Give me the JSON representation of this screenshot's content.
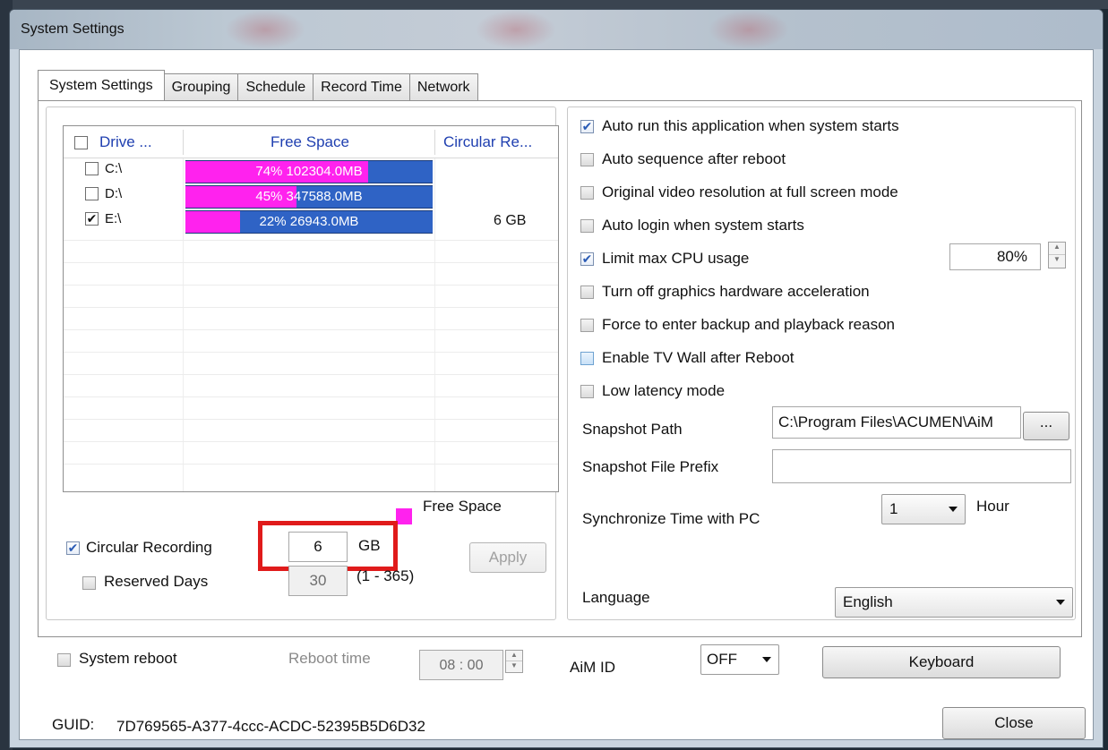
{
  "window": {
    "title": "System Settings"
  },
  "tabs": [
    {
      "label": "System Settings",
      "active": true
    },
    {
      "label": "Grouping",
      "active": false
    },
    {
      "label": "Schedule",
      "active": false
    },
    {
      "label": "Record Time",
      "active": false
    },
    {
      "label": "Network",
      "active": false
    }
  ],
  "drives": {
    "columns": [
      "Drive ...",
      "Free Space",
      "Circular Re..."
    ],
    "rows": [
      {
        "drive": "C:\\",
        "checked": false,
        "free_percent": 74,
        "free_text": "74%   102304.0MB",
        "circular": ""
      },
      {
        "drive": "D:\\",
        "checked": false,
        "free_percent": 45,
        "free_text": "45%   347588.0MB",
        "circular": ""
      },
      {
        "drive": "E:\\",
        "checked": true,
        "free_percent": 22,
        "free_text": "22%   26943.0MB",
        "circular": "6 GB"
      }
    ]
  },
  "legend": {
    "label": "Free Space",
    "color": "#ff22ee"
  },
  "circular": {
    "label": "Circular Recording",
    "checked": true,
    "value": "6",
    "unit": "GB",
    "reserved_label": "Reserved Days",
    "reserved_checked": false,
    "reserved_value": "30",
    "reserved_range": "(1 - 365)",
    "apply_label": "Apply"
  },
  "options": [
    {
      "label": "Auto run this application when system starts",
      "checked": true
    },
    {
      "label": "Auto sequence after reboot",
      "checked": false
    },
    {
      "label": "Original video resolution at full screen mode",
      "checked": false
    },
    {
      "label": "Auto login when system starts",
      "checked": false
    },
    {
      "label": "Limit max CPU usage",
      "checked": true
    },
    {
      "label": "Turn off graphics hardware acceleration",
      "checked": false
    },
    {
      "label": "Force to enter backup and playback reason",
      "checked": false
    },
    {
      "label": "Enable TV Wall after Reboot",
      "checked": false
    },
    {
      "label": "Low latency mode",
      "checked": false
    }
  ],
  "cpu_limit": "80%",
  "snapshot": {
    "path_label": "Snapshot Path",
    "path_value": "C:\\Program Files\\ACUMEN\\AiM",
    "browse_label": "...",
    "prefix_label": "Snapshot File Prefix",
    "prefix_value": ""
  },
  "sync": {
    "label": "Synchronize Time with PC",
    "value": "1",
    "unit": "Hour"
  },
  "language": {
    "label": "Language",
    "value": "English"
  },
  "reboot": {
    "label": "System reboot",
    "checked": false,
    "time_label": "Reboot time",
    "time_value": "08 : 00"
  },
  "aim_id": {
    "label": "AiM ID",
    "value": "OFF"
  },
  "keyboard_label": "Keyboard",
  "guid": {
    "label": "GUID:",
    "value": "7D769565-A377-4ccc-ACDC-52395B5D6D32"
  },
  "close_label": "Close"
}
